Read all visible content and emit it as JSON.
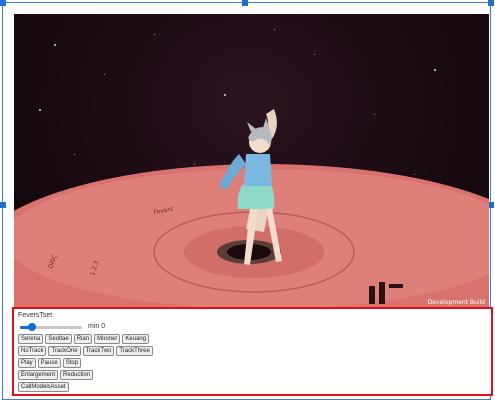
{
  "viewport": {
    "dev_build_label": "Development Build"
  },
  "panel": {
    "title": "FeversTset",
    "slider": {
      "label": "min 0",
      "value": 0
    },
    "row1": [
      "Serena",
      "Seoltae",
      "Rian",
      "Mooner",
      "Keuang"
    ],
    "row2": [
      "NoTrack",
      "TrackOne",
      "TrackTwo",
      "TrackThree"
    ],
    "row3": [
      "Play",
      "Pause",
      "Stop"
    ],
    "row4": [
      "Enlargement",
      "Reduction"
    ],
    "row5": [
      "CallModelsAsset"
    ]
  },
  "colors": {
    "panel_border": "#e0101a",
    "selection_border": "#3a7fd4",
    "slider_accent": "#0a6cd6",
    "disc": "#d9726d"
  }
}
